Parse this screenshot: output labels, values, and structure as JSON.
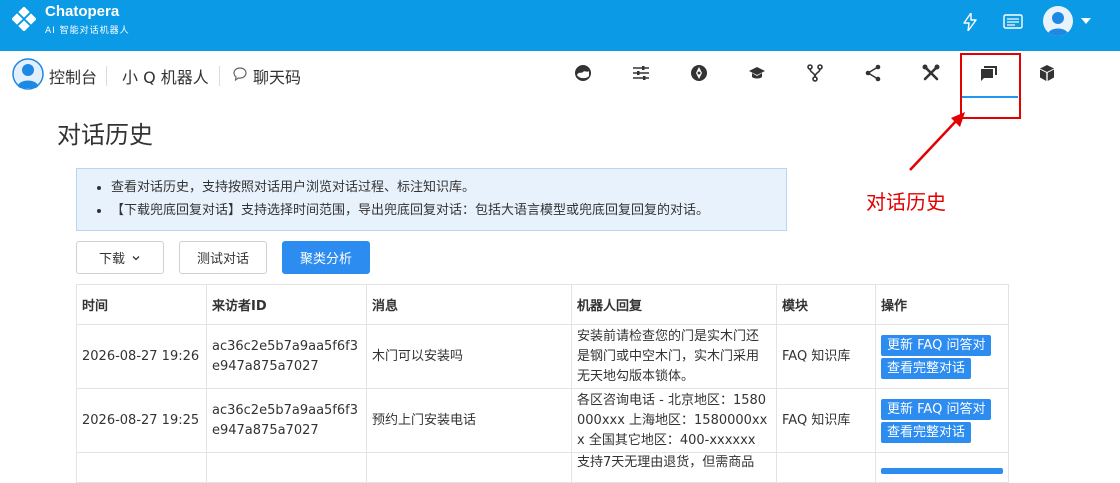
{
  "brand": {
    "name": "Chatopera",
    "subtitle": "AI 智能对话机器人"
  },
  "topbar": {
    "icons": [
      "bolt-icon",
      "card-icon",
      "avatar",
      "chevron-down-icon"
    ]
  },
  "navbar": {
    "console": "控制台",
    "bot_name": "小 Q 机器人",
    "chat_code": "聊天码",
    "icons": [
      "dashboard-icon",
      "sliders-icon",
      "compass-icon",
      "graduation-cap-icon",
      "fork-icon",
      "share-icon",
      "tools-icon",
      "chat-history-icon",
      "cube-icon"
    ],
    "active": "chat-history-icon"
  },
  "annotation": "对话历史",
  "page": {
    "title": "对话历史"
  },
  "info": [
    "查看对话历史，支持按照对话用户浏览对话过程、标注知识库。",
    "【下载兜底回复对话】支持选择时间范围，导出兜底回复对话：包括大语言模型或兜底回复回复的对话。"
  ],
  "buttons": {
    "download": "下载",
    "test": "测试对话",
    "cluster": "聚类分析"
  },
  "table": {
    "headers": [
      "时间",
      "来访者ID",
      "消息",
      "机器人回复",
      "模块",
      "操作"
    ],
    "rows": [
      {
        "time": "2026-08-27 19:26",
        "visitor": "ac36c2e5b7a9aa5f6f3e947a875a7027",
        "message": "木门可以安装吗",
        "reply": "安装前请检查您的门是实木门还是钢门或中空木门，实木门采用无天地勾版本锁体。",
        "module": "FAQ 知识库",
        "op1": "更新 FAQ 问答对",
        "op2": "查看完整对话"
      },
      {
        "time": "2026-08-27 19:25",
        "visitor": "ac36c2e5b7a9aa5f6f3e947a875a7027",
        "message": "预约上门安装电话",
        "reply": "各区咨询电话 - 北京地区：1580000xxx 上海地区：1580000xxx 全国其它地区：400-xxxxxx",
        "module": "FAQ 知识库",
        "op1": "更新 FAQ 问答对",
        "op2": "查看完整对话"
      },
      {
        "reply": "支持7天无理由退货，但需商品"
      }
    ]
  }
}
